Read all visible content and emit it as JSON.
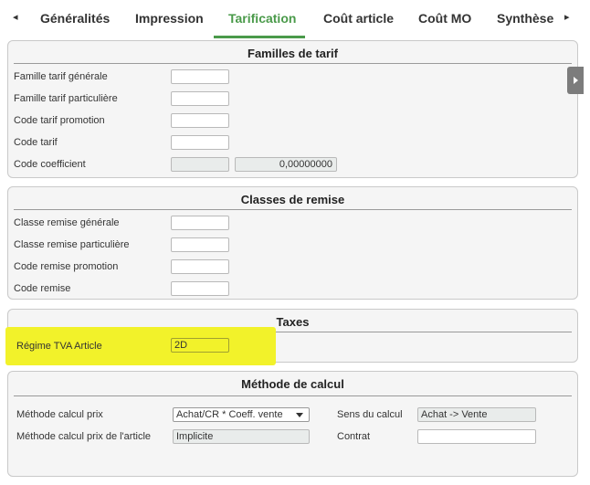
{
  "tabs": {
    "items": [
      {
        "label": "Généralités"
      },
      {
        "label": "Impression"
      },
      {
        "label": "Tarification"
      },
      {
        "label": "Coût article"
      },
      {
        "label": "Coût MO"
      },
      {
        "label": "Synthèse"
      }
    ],
    "active_index": 2,
    "prev_arrow": "◂",
    "next_arrow": "▸"
  },
  "familles": {
    "title": "Familles de tarif",
    "fields": [
      {
        "label": "Famille tarif générale",
        "value": ""
      },
      {
        "label": "Famille tarif particulière",
        "value": ""
      },
      {
        "label": "Code tarif promotion",
        "value": ""
      },
      {
        "label": "Code tarif",
        "value": ""
      },
      {
        "label": "Code coefficient",
        "value": "",
        "coef_value": "0,00000000"
      }
    ]
  },
  "classes": {
    "title": "Classes de remise",
    "fields": [
      {
        "label": "Classe remise générale",
        "value": ""
      },
      {
        "label": "Classe remise particulière",
        "value": ""
      },
      {
        "label": "Code remise promotion",
        "value": ""
      },
      {
        "label": "Code remise",
        "value": ""
      }
    ]
  },
  "taxes": {
    "title": "Taxes",
    "regime_label": "Régime TVA Article",
    "regime_value": "2D"
  },
  "methode": {
    "title": "Méthode de calcul",
    "prix_label": "Méthode calcul prix",
    "prix_value": "Achat/CR * Coeff. vente",
    "prix_article_label": "Méthode calcul prix de l'article",
    "prix_article_value": "Implicite",
    "sens_label": "Sens du calcul",
    "sens_value": "Achat -> Vente",
    "contrat_label": "Contrat",
    "contrat_value": ""
  },
  "colors": {
    "accent": "#4a9a4a",
    "highlight": "#f2f22a",
    "panel_bg": "#f5f5f5"
  }
}
